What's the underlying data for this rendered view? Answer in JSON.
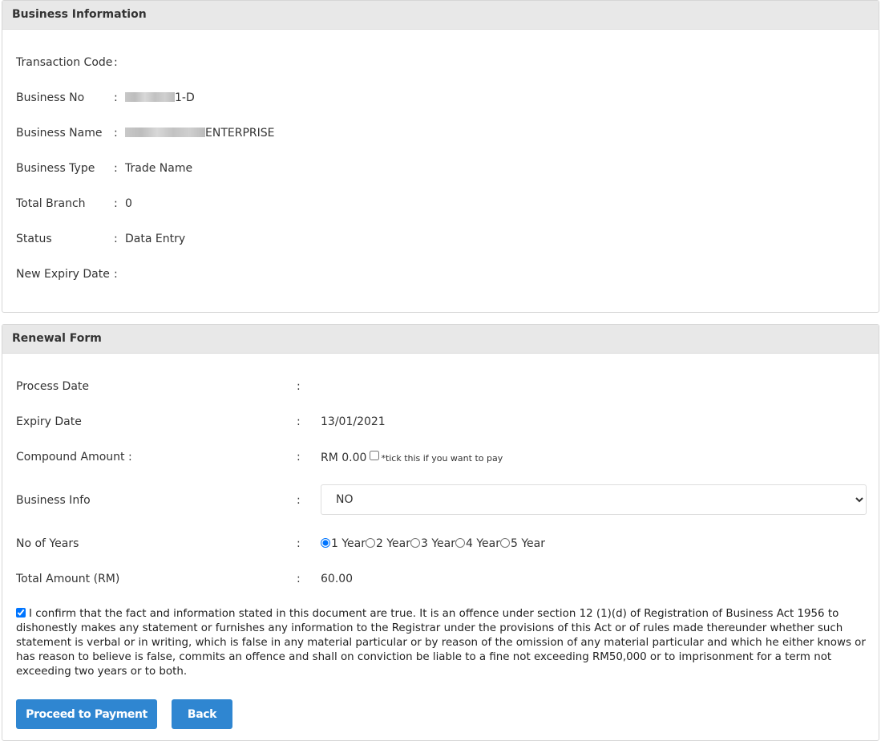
{
  "business_info": {
    "title": "Business Information",
    "fields": [
      {
        "label": "Transaction Code",
        "value": ""
      },
      {
        "label": "Business No",
        "value": "1-D",
        "redacted": true
      },
      {
        "label": "Business Name",
        "value": "ENTERPRISE",
        "redacted": true
      },
      {
        "label": "Business Type",
        "value": "Trade Name"
      },
      {
        "label": "Total Branch",
        "value": "0"
      },
      {
        "label": "Status",
        "value": "Data Entry"
      },
      {
        "label": "New Expiry Date",
        "value": ""
      }
    ]
  },
  "renewal_form": {
    "title": "Renewal Form",
    "process_date": {
      "label": "Process Date",
      "value": ""
    },
    "expiry_date": {
      "label": "Expiry Date",
      "value": "13/01/2021"
    },
    "compound_amount": {
      "label": "Compound Amount :",
      "value": "RM 0.00",
      "checked": false,
      "note": "*tick this if you want to pay"
    },
    "business_info": {
      "label": "Business Info",
      "selected": "NO"
    },
    "no_of_years": {
      "label": "No of Years",
      "options": [
        "1 Year",
        "2 Year",
        "3 Year",
        "4 Year",
        "5 Year"
      ],
      "selected": "1 Year"
    },
    "total_amount": {
      "label": "Total Amount (RM)",
      "value": "60.00"
    },
    "confirmation": {
      "checked": true,
      "text": "I confirm that the fact and information stated in this document are true. It is an offence under section 12 (1)(d) of Registration of Business Act 1956 to dishonestly makes any statement or furnishes any information to the Registrar under the provisions of this Act or of rules made thereunder whether such statement is verbal or in writing, which is false in any material particular or by reason of the omission of any material particular and which he either knows or has reason to believe is false, commits an offence and shall on conviction be liable to a fine not exceeding RM50,000 or to imprisonment for a term not exceeding two years or to both."
    },
    "buttons": {
      "proceed": "Proceed to Payment",
      "back": "Back"
    }
  },
  "colors": {
    "accent": "#2f86d1",
    "header_bg": "#e8e8e8"
  }
}
